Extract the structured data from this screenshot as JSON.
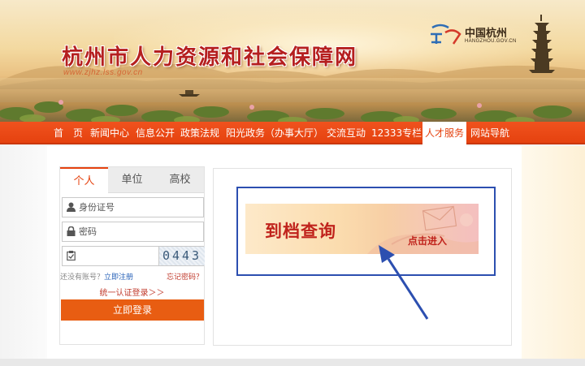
{
  "header": {
    "site_title": "杭州市人力资源和社会保障网",
    "site_url": "www.zjhz.lss.gov.cn",
    "brand_name": "中国杭州",
    "brand_domain": "HANGZHOU.GOV.CN"
  },
  "nav": {
    "items": [
      {
        "label": "首　页"
      },
      {
        "label": "新闻中心"
      },
      {
        "label": "信息公开"
      },
      {
        "label": "政策法规"
      },
      {
        "label": "阳光政务（办事大厅）"
      },
      {
        "label": "交流互动"
      },
      {
        "label": "12333专栏"
      },
      {
        "label": "人才服务",
        "active": true
      },
      {
        "label": "网站导航"
      }
    ]
  },
  "login": {
    "tabs": [
      {
        "label": "个人",
        "active": true
      },
      {
        "label": "单位"
      },
      {
        "label": "高校"
      }
    ],
    "id_placeholder": "身份证号",
    "password_placeholder": "密码",
    "captcha_code": "0443",
    "no_account": "还没有账号？",
    "register_link": "立即注册",
    "forgot_link": "忘记密码？",
    "unified_login": "统一认证登录＞＞",
    "login_button": "立即登录"
  },
  "promo": {
    "title": "到档查询",
    "enter": "点击进入"
  },
  "colors": {
    "nav_orange": "#e5420f",
    "button_orange": "#e85d12",
    "title_red": "#b51f1f",
    "highlight_blue": "#2c4fb0"
  }
}
